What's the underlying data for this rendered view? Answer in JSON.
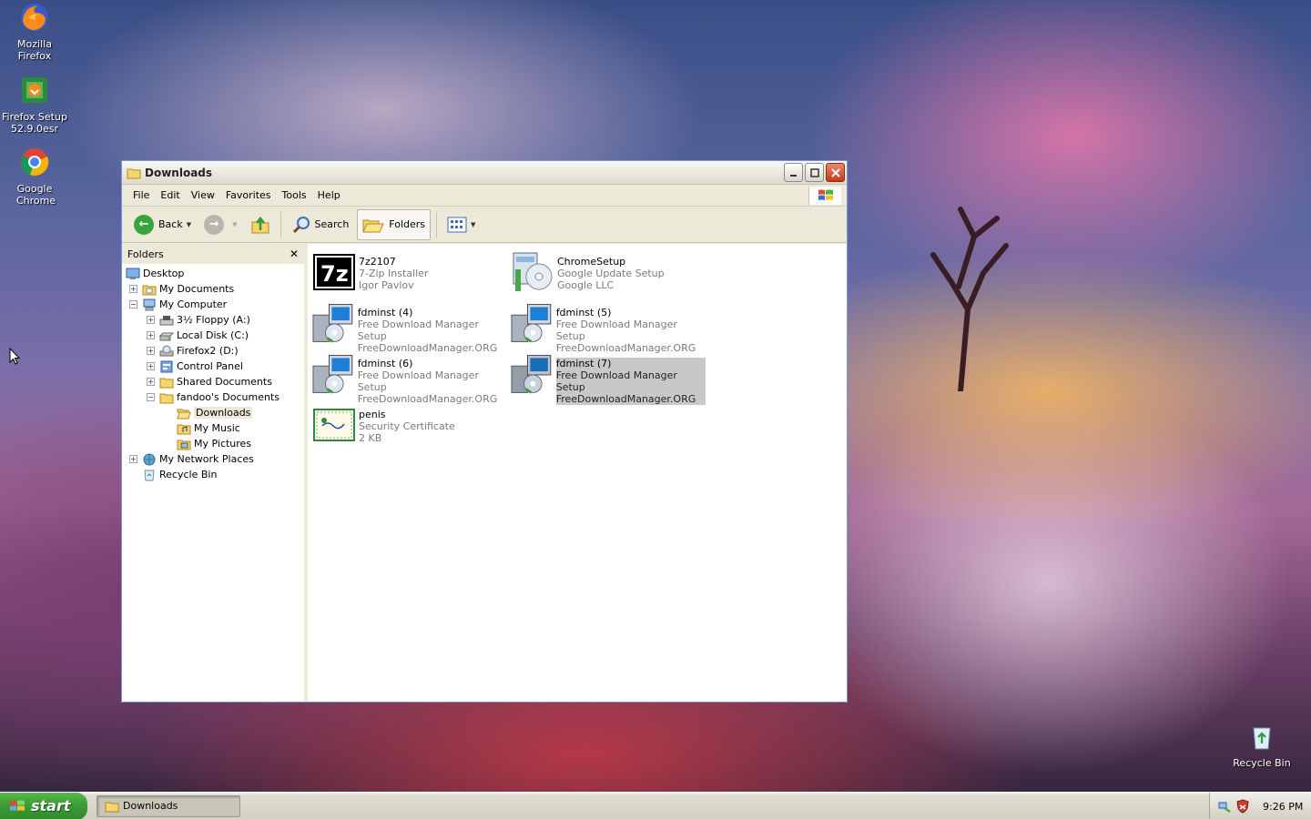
{
  "desktop": {
    "icons": [
      {
        "label": "Mozilla Firefox"
      },
      {
        "label": "Firefox Setup 52.9.0esr"
      },
      {
        "label": "Google Chrome"
      },
      {
        "label": "Recycle Bin"
      }
    ]
  },
  "window": {
    "title": "Downloads",
    "menu": [
      "File",
      "Edit",
      "View",
      "Favorites",
      "Tools",
      "Help"
    ],
    "toolbar": {
      "back_label": "Back",
      "search_label": "Search",
      "folders_label": "Folders"
    },
    "folders_pane": {
      "header": "Folders",
      "close_glyph": "✕",
      "tree": [
        {
          "label": "Desktop"
        },
        {
          "label": "My Documents"
        },
        {
          "label": "My Computer"
        },
        {
          "label": "3½ Floppy (A:)"
        },
        {
          "label": "Local Disk (C:)"
        },
        {
          "label": "Firefox2 (D:)"
        },
        {
          "label": "Control Panel"
        },
        {
          "label": "Shared Documents"
        },
        {
          "label": "fandoo's Documents"
        },
        {
          "label": "Downloads"
        },
        {
          "label": "My Music"
        },
        {
          "label": "My Pictures"
        },
        {
          "label": "My Network Places"
        },
        {
          "label": "Recycle Bin"
        }
      ]
    },
    "files": [
      {
        "name": "7z2107",
        "line1": "7-Zip Installer",
        "line2": "Igor Pavlov"
      },
      {
        "name": "ChromeSetup",
        "line1": "Google Update Setup",
        "line2": "Google LLC"
      },
      {
        "name": "fdminst (4)",
        "line1": "Free Download Manager Setup",
        "line2": "FreeDownloadManager.ORG"
      },
      {
        "name": "fdminst (5)",
        "line1": "Free Download Manager Setup",
        "line2": "FreeDownloadManager.ORG"
      },
      {
        "name": "fdminst (6)",
        "line1": "Free Download Manager Setup",
        "line2": "FreeDownloadManager.ORG"
      },
      {
        "name": "fdminst (7)",
        "line1": "Free Download Manager Setup",
        "line2": "FreeDownloadManager.ORG"
      },
      {
        "name": "penis",
        "line1": "Security Certificate",
        "line2": "2 KB"
      }
    ]
  },
  "taskbar": {
    "start_label": "start",
    "task_label": "Downloads",
    "clock": "9:26 PM"
  },
  "colors": {
    "accent": "#3c9c36",
    "titlebar": "#ece9d8",
    "selection": "#c8c8c8"
  }
}
